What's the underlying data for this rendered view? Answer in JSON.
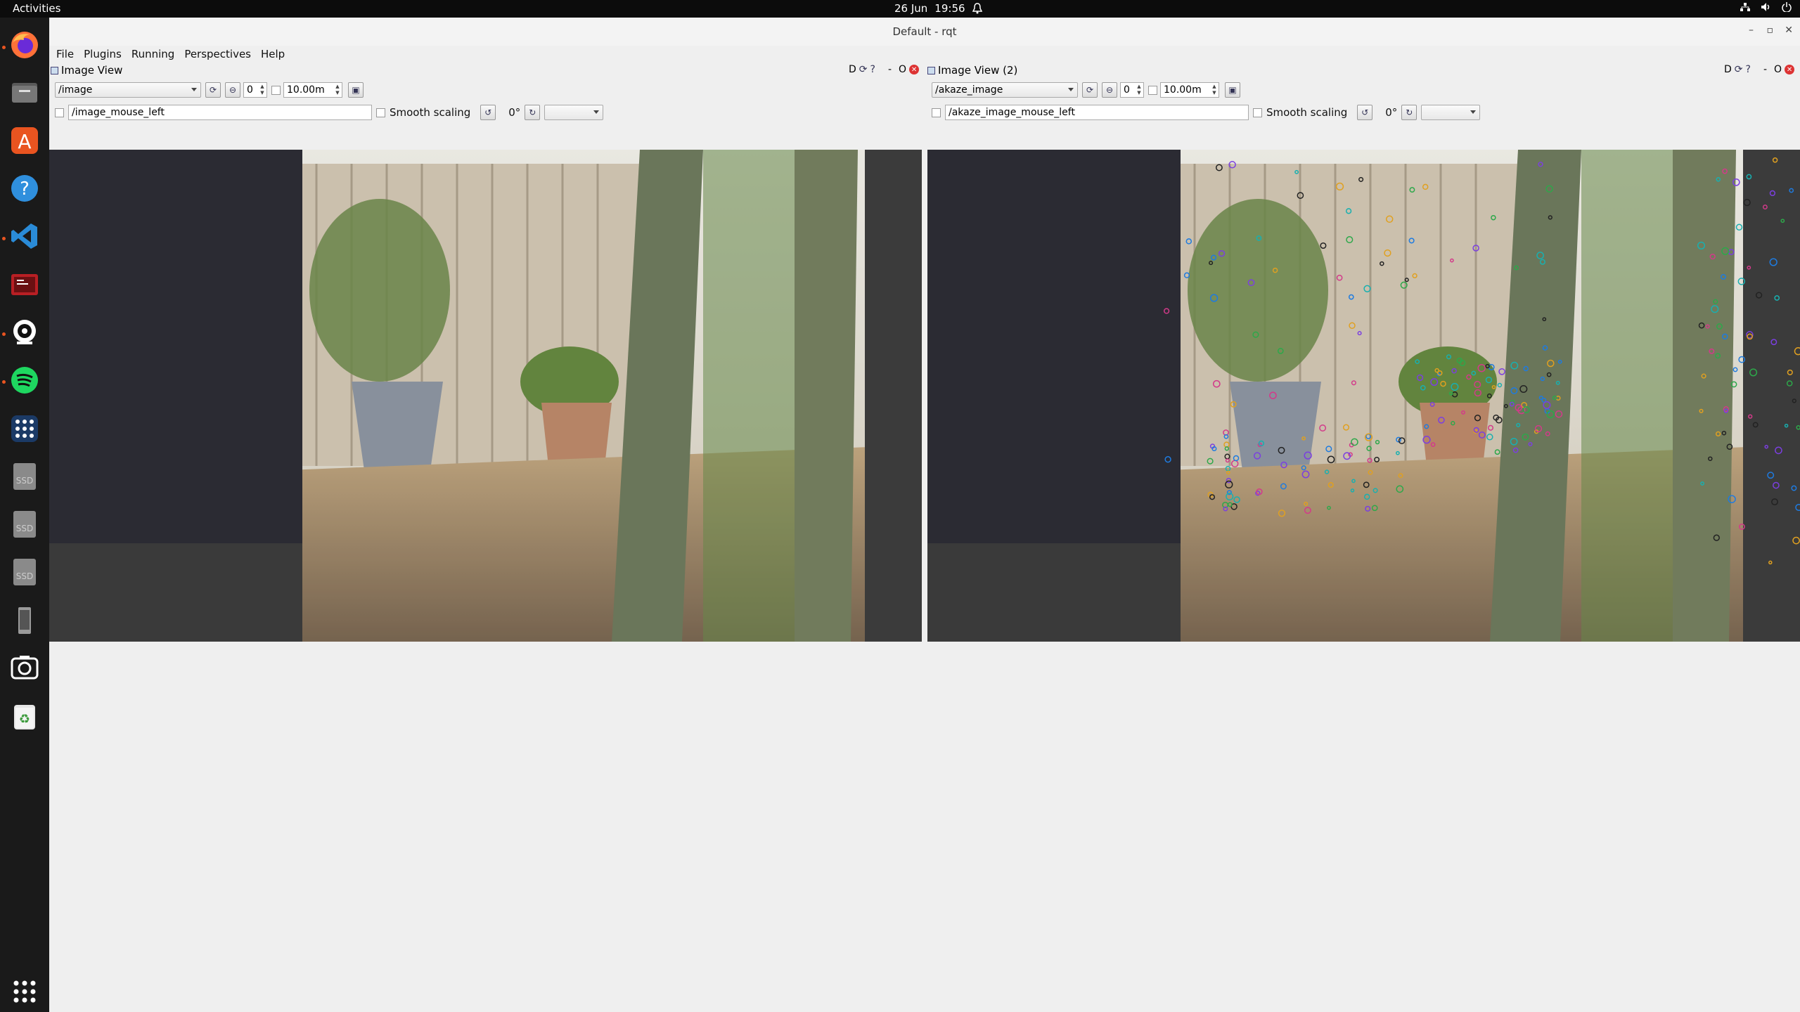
{
  "topbar": {
    "activities": "Activities",
    "date": "26 Jun",
    "time": "19:56"
  },
  "dock": {
    "items": [
      "firefox-icon",
      "files-icon",
      "app-center-icon",
      "help-icon",
      "vscode-icon",
      "terminal-app-icon",
      "webcam-icon",
      "spotify-icon",
      "dots-app-icon",
      "ssd-drive-icon",
      "ssd-drive-icon",
      "ssd-drive-icon",
      "removable-drive-icon",
      "screenshot-icon",
      "trash-icon",
      "show-apps-icon"
    ]
  },
  "window": {
    "title": "Default - rqt",
    "menu": [
      "File",
      "Plugins",
      "Running",
      "Perspectives",
      "Help"
    ]
  },
  "left_pane": {
    "title": "Image View",
    "topic": "/image",
    "zoom_value": "0",
    "time_value": "10.00m",
    "mouse_topic": "/image_mouse_left",
    "smooth_label": "Smooth scaling",
    "rotation": "0°",
    "ctrl_letters": "D",
    "dash": "-",
    "o": "O"
  },
  "right_pane": {
    "title": "Image View (2)",
    "topic": "/akaze_image",
    "zoom_value": "0",
    "time_value": "10.00m",
    "mouse_topic": "/akaze_image_mouse_left",
    "smooth_label": "Smooth scaling",
    "rotation": "0°",
    "ctrl_letters": "D",
    "dash": "-",
    "o": "O"
  }
}
